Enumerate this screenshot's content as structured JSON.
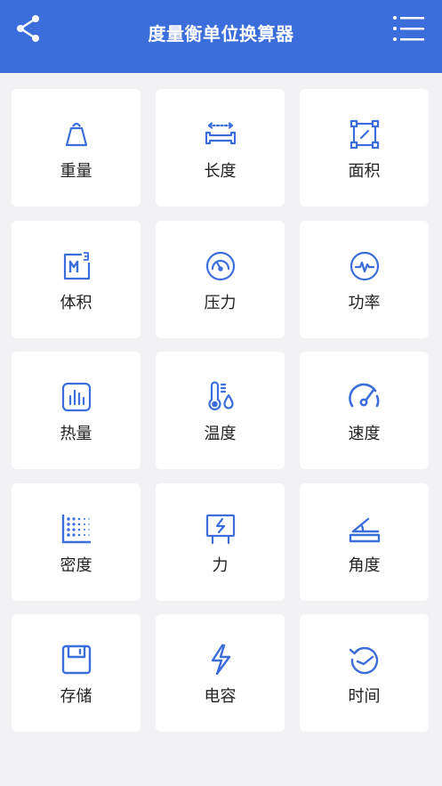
{
  "header": {
    "title": "度量衡单位换算器",
    "share_icon": "share-icon",
    "menu_icon": "menu-list-icon"
  },
  "colors": {
    "header_bg": "#3c6edb",
    "icon": "#3c6edb",
    "card_bg": "#ffffff",
    "page_bg": "#f2f2f4"
  },
  "categories": [
    {
      "label": "重量",
      "icon": "weight-icon"
    },
    {
      "label": "长度",
      "icon": "length-icon"
    },
    {
      "label": "面积",
      "icon": "area-icon"
    },
    {
      "label": "体积",
      "icon": "volume-icon"
    },
    {
      "label": "压力",
      "icon": "pressure-gauge-icon"
    },
    {
      "label": "功率",
      "icon": "power-icon"
    },
    {
      "label": "热量",
      "icon": "heat-chart-icon"
    },
    {
      "label": "温度",
      "icon": "thermometer-icon"
    },
    {
      "label": "速度",
      "icon": "speedometer-icon"
    },
    {
      "label": "密度",
      "icon": "density-dots-icon"
    },
    {
      "label": "力",
      "icon": "force-board-icon"
    },
    {
      "label": "角度",
      "icon": "angle-icon"
    },
    {
      "label": "存储",
      "icon": "floppy-disk-icon"
    },
    {
      "label": "电容",
      "icon": "lightning-icon"
    },
    {
      "label": "时间",
      "icon": "clock-rotate-icon"
    }
  ]
}
